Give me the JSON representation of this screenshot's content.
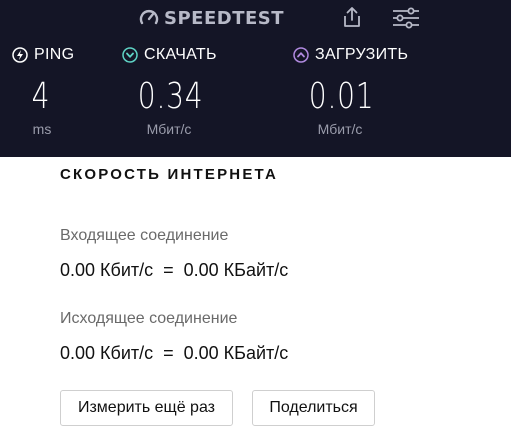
{
  "header": {
    "logo_text": "SPEEDTEST",
    "share_icon": "share-icon",
    "settings_icon": "settings-sliders-icon"
  },
  "metrics": [
    {
      "icon": "ping-icon",
      "label": "PING",
      "value": "4",
      "unit": "ms",
      "icon_color": "#ffffff"
    },
    {
      "icon": "download-icon",
      "label": "СКАЧАТЬ",
      "value": "0.34",
      "unit": "Мбит/с",
      "icon_color": "#5fd4c6"
    },
    {
      "icon": "upload-icon",
      "label": "ЗАГРУЗИТЬ",
      "value": "0.01",
      "unit": "Мбит/с",
      "icon_color": "#b18ae0"
    }
  ],
  "widget": {
    "title": "СКОРОСТЬ ИНТЕРНЕТА",
    "incoming_label": "Входящее соединение",
    "incoming_value": "0.00 Кбит/с  =  0.00 КБайт/с",
    "outgoing_label": "Исходящее соединение",
    "outgoing_value": "0.00 Кбит/с  =  0.00 КБайт/с",
    "remeasure_button": "Измерить ещё раз",
    "share_button": "Поделиться"
  },
  "colors": {
    "header_bg": "#141526",
    "download_accent": "#5fd4c6",
    "upload_accent": "#b18ae0"
  }
}
